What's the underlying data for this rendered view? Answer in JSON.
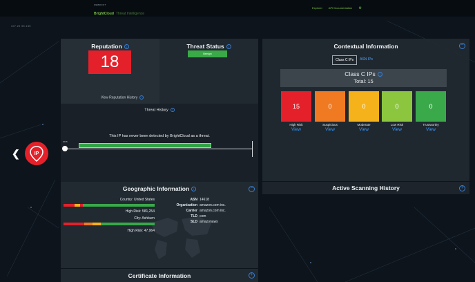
{
  "header": {
    "brand_small": "WEBROOT",
    "brand_name": "BrightCloud",
    "brand_sub": "Threat Intelligence",
    "nav": [
      "Explorer",
      "API Documentation"
    ],
    "ip_address": "107.20.95.155"
  },
  "reputation": {
    "title": "Reputation",
    "score": "18",
    "history_link": "View Reputation History",
    "score_color": "#e4212a"
  },
  "threat_status": {
    "title": "Threat Status",
    "status": "Benign",
    "status_color": "#3aaa48"
  },
  "threat_history": {
    "title": "Threat History",
    "message": "This IP has never been detected by BrightCloud as a threat.",
    "year": "2016"
  },
  "contextual": {
    "title": "Contextual Information",
    "tabs": [
      "Class C IPs",
      "ASN IPs"
    ],
    "heading": "Class C IPs",
    "total": "Total: 15",
    "categories": [
      {
        "label": "High Risk",
        "count": "15",
        "view": "View",
        "color": "#e4212a"
      },
      {
        "label": "Suspicious",
        "count": "0",
        "view": "View",
        "color": "#f07a22"
      },
      {
        "label": "Moderate",
        "count": "0",
        "view": "View",
        "color": "#f5b21a"
      },
      {
        "label": "Low Risk",
        "count": "0",
        "view": "View",
        "color": "#8cc63f"
      },
      {
        "label": "Trustworthy",
        "count": "0",
        "view": "View",
        "color": "#39a94a"
      }
    ]
  },
  "active_scanning": {
    "title": "Active Scanning History"
  },
  "geographic": {
    "title": "Geographic Information",
    "country": "Country: United States",
    "country_risk": "High Risk: 581,254",
    "city": "City: Ashburn",
    "city_risk": "High Risk: 47,964",
    "fields": [
      {
        "key": "ASN",
        "value": "14618"
      },
      {
        "key": "Organization",
        "value": "amazon.com inc."
      },
      {
        "key": "Carrier",
        "value": "amazon.com inc."
      },
      {
        "key": "TLD",
        "value": "com"
      },
      {
        "key": "SLD",
        "value": "amazonaws"
      }
    ]
  },
  "certificate": {
    "title": "Certificate Information"
  },
  "sidebar": {
    "pin_label": "IP"
  }
}
